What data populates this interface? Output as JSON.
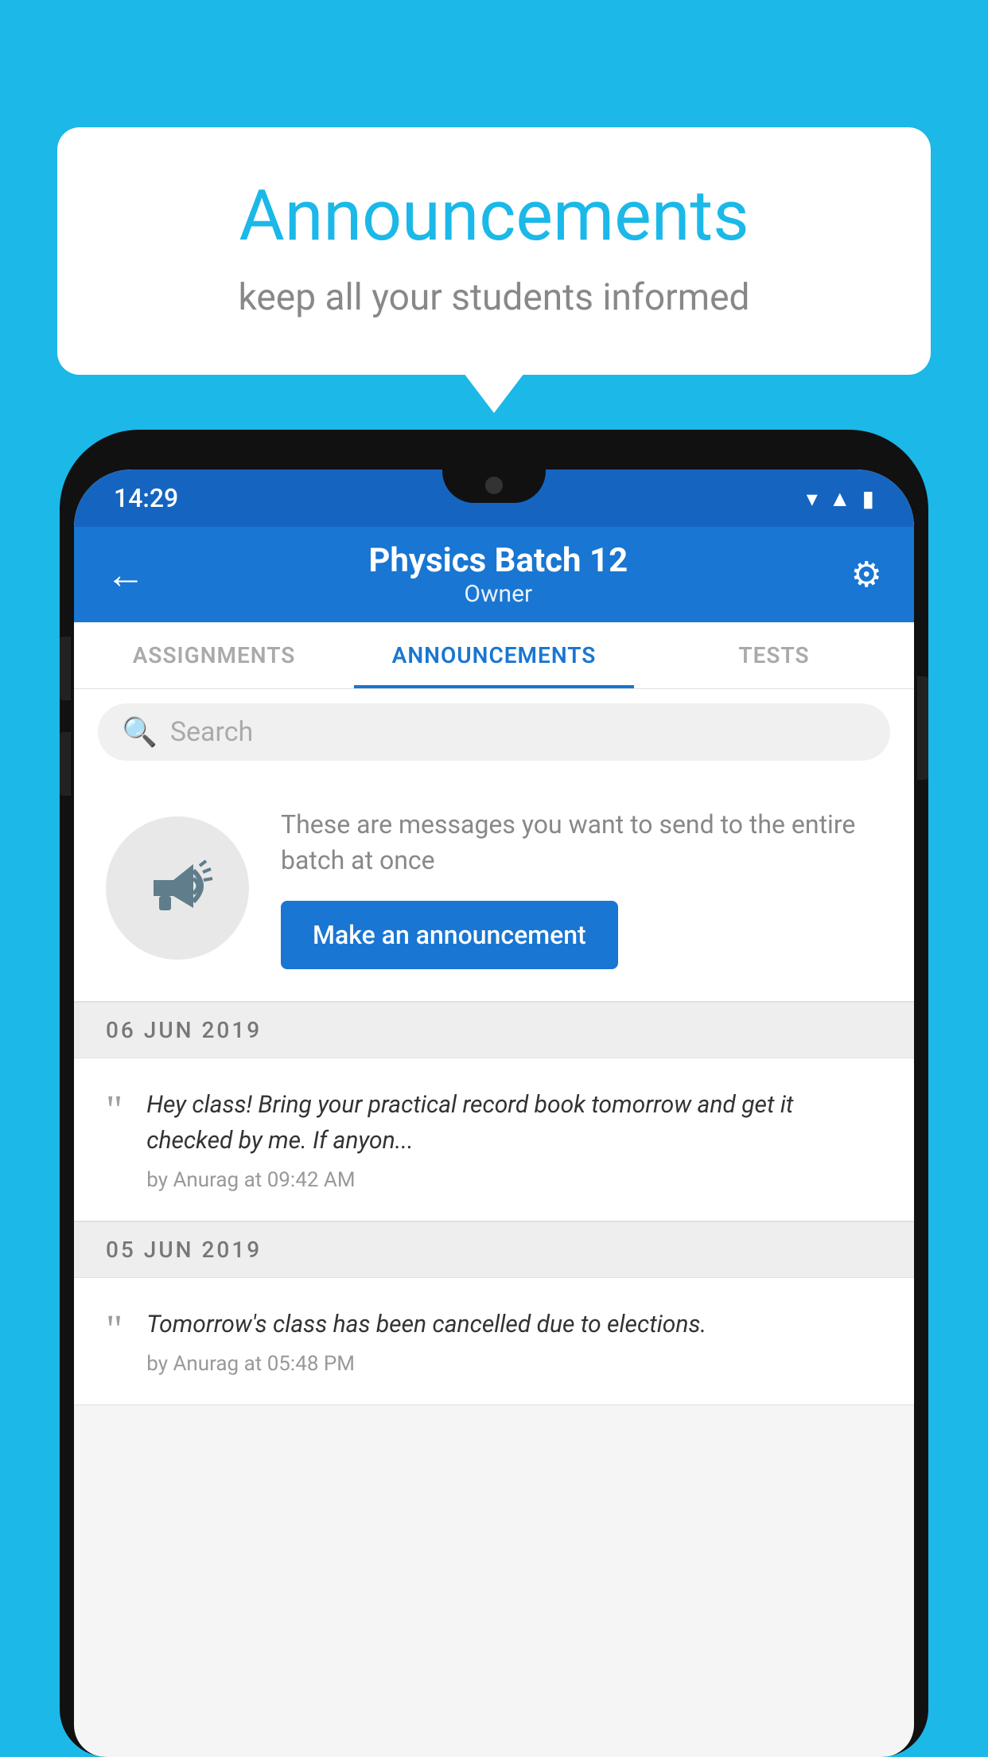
{
  "bubble": {
    "title": "Announcements",
    "subtitle": "keep all your students informed"
  },
  "status_bar": {
    "time": "14:29",
    "icons": [
      "wifi",
      "signal",
      "battery"
    ]
  },
  "app_header": {
    "title": "Physics Batch 12",
    "subtitle": "Owner",
    "back_label": "←",
    "settings_label": "⚙"
  },
  "tabs": [
    {
      "label": "ASSIGNMENTS",
      "active": false
    },
    {
      "label": "ANNOUNCEMENTS",
      "active": true
    },
    {
      "label": "TESTS",
      "active": false
    },
    {
      "label": "...",
      "active": false
    }
  ],
  "search": {
    "placeholder": "Search"
  },
  "promo": {
    "text": "These are messages you want to send to the entire batch at once",
    "button_label": "Make an announcement"
  },
  "announcements": [
    {
      "date": "06  JUN  2019",
      "text": "Hey class! Bring your practical record book tomorrow and get it checked by me. If anyon...",
      "meta": "by Anurag at 09:42 AM"
    },
    {
      "date": "05  JUN  2019",
      "text": "Tomorrow's class has been cancelled due to elections.",
      "meta": "by Anurag at 05:48 PM"
    }
  ]
}
